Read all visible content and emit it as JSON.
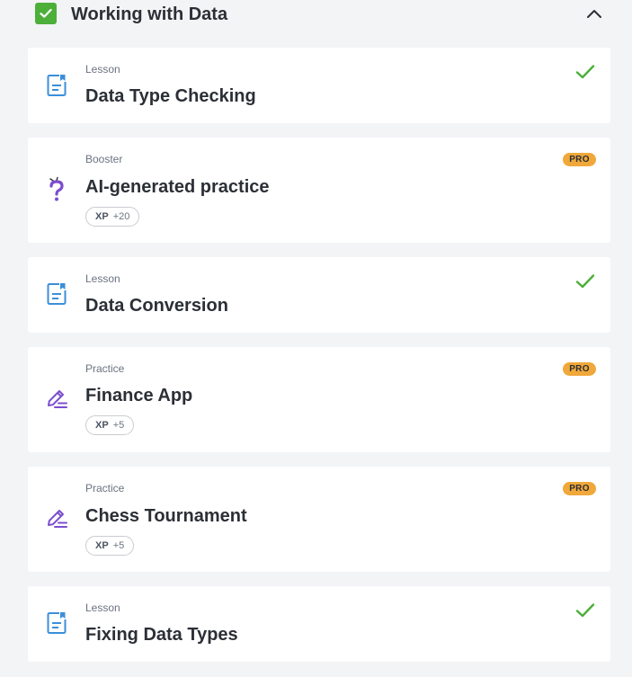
{
  "section": {
    "title": "Working with Data",
    "completed": true,
    "expanded": true
  },
  "colors": {
    "completed_green": "#4caf3a",
    "pro_orange": "#f0a83a",
    "lesson_icon_blue": "#3b8fd9",
    "practice_icon_purple": "#7c4dce"
  },
  "items": [
    {
      "type": "Lesson",
      "title": "Data Type Checking",
      "icon": "lesson-document-icon",
      "completed": true
    },
    {
      "type": "Booster",
      "title": "AI-generated practice",
      "icon": "question-mark-icon",
      "pro": "PRO",
      "xp_label": "XP",
      "xp_value": "+20"
    },
    {
      "type": "Lesson",
      "title": "Data Conversion",
      "icon": "lesson-document-icon",
      "completed": true
    },
    {
      "type": "Practice",
      "title": "Finance App",
      "icon": "pencil-icon",
      "pro": "PRO",
      "xp_label": "XP",
      "xp_value": "+5"
    },
    {
      "type": "Practice",
      "title": "Chess Tournament",
      "icon": "pencil-icon",
      "pro": "PRO",
      "xp_label": "XP",
      "xp_value": "+5"
    },
    {
      "type": "Lesson",
      "title": "Fixing Data Types",
      "icon": "lesson-document-icon",
      "completed": true
    }
  ]
}
